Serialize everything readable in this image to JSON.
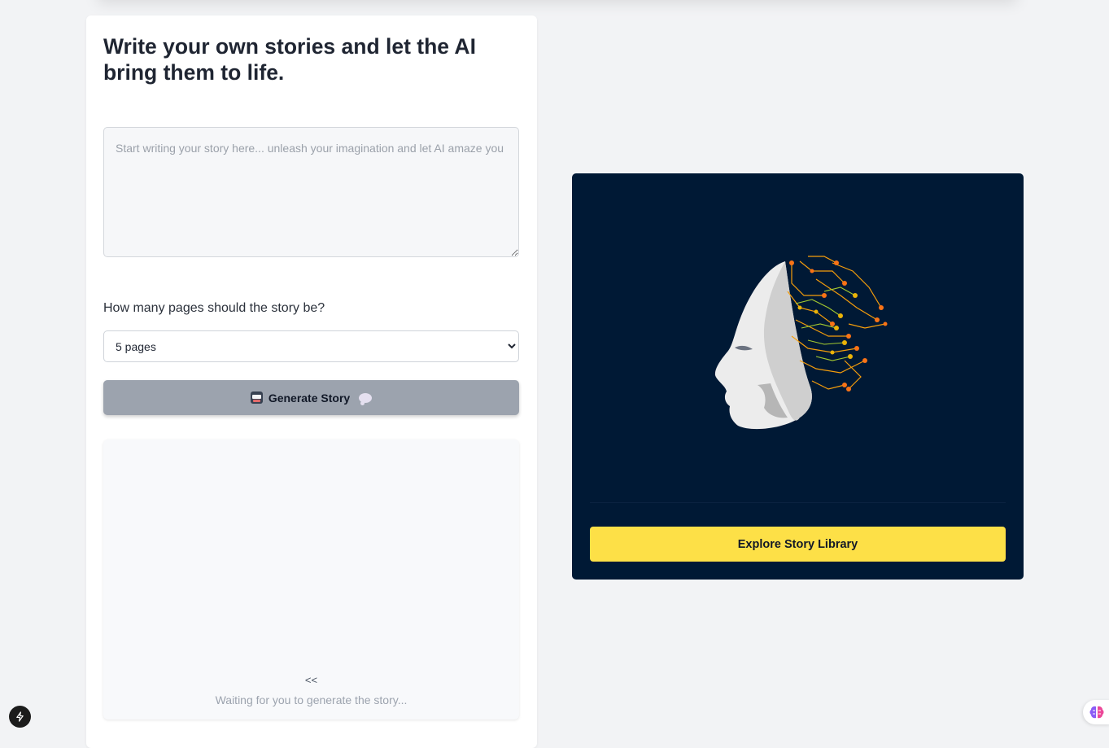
{
  "main": {
    "title": "Write your own stories and let the AI bring them to life.",
    "story_input": {
      "value": "",
      "placeholder": "Start writing your story here... unleash your imagination and let AI amaze you"
    },
    "pages_label": "How many pages should the story be?",
    "pages_select": {
      "selected": "5 pages"
    },
    "generate_button": {
      "label": "Generate Story",
      "icons": [
        "robot-icon",
        "speech-bubble-icon"
      ],
      "color": "#9ca3ae"
    },
    "output": {
      "prev_label": "<<",
      "status": "Waiting for you to generate the story..."
    }
  },
  "library_card": {
    "image_alt_icon": "ai-head-circuit-brain-icon",
    "background": "#001935",
    "button_label": "Explore Story Library",
    "button_color": "#fde047"
  },
  "widgets": {
    "bottom_left_icon": "lightning-bolt-icon",
    "bottom_right_icon": "brain-icon"
  }
}
